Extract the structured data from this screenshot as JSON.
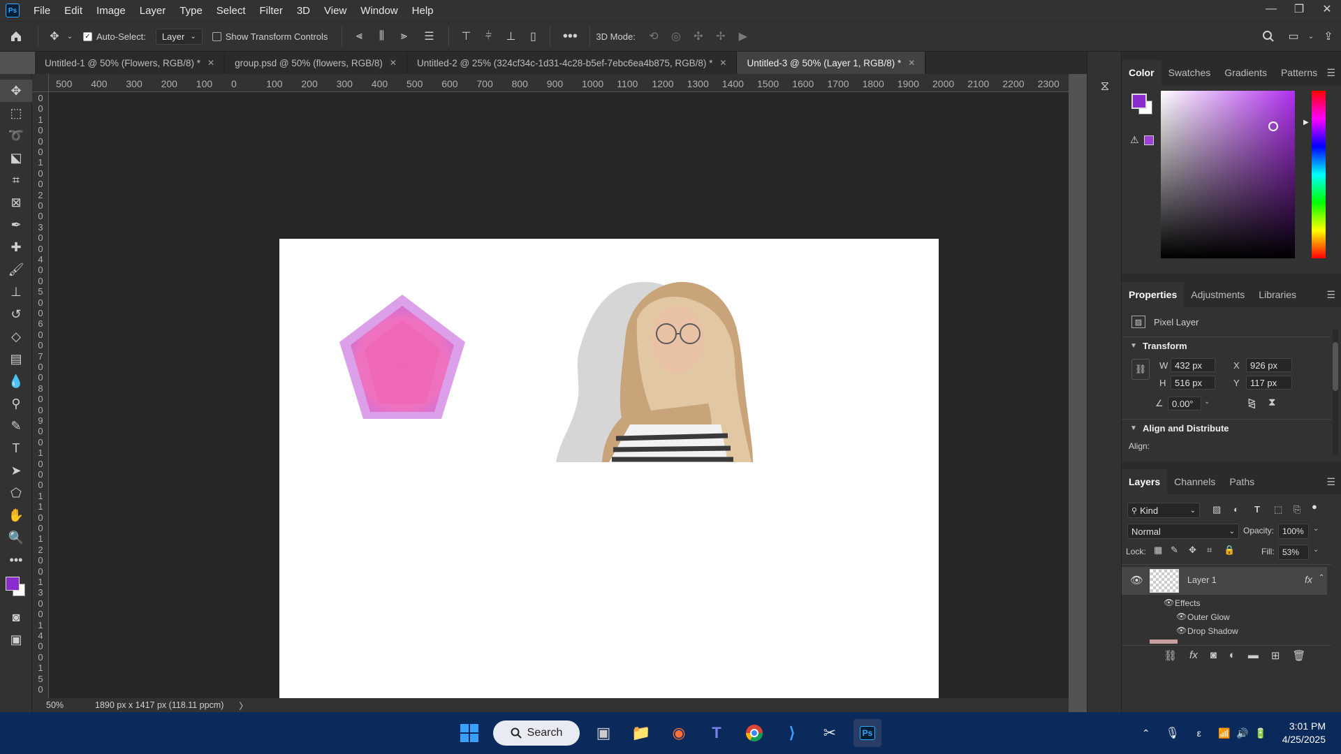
{
  "menubar": {
    "logo": "Ps",
    "items": [
      "File",
      "Edit",
      "Image",
      "Layer",
      "Type",
      "Select",
      "Filter",
      "3D",
      "View",
      "Window",
      "Help"
    ]
  },
  "options": {
    "auto_select_label": "Auto-Select:",
    "auto_select_value": "Layer",
    "show_transform_label": "Show Transform Controls",
    "three_d_mode_label": "3D Mode:"
  },
  "tabs": [
    {
      "label": "Untitled-1 @ 50% (Flowers, RGB/8) *",
      "active": false
    },
    {
      "label": "group.psd @ 50% (flowers, RGB/8)",
      "active": false
    },
    {
      "label": "Untitled-2 @ 25% (324cf34c-1d31-4c28-b5ef-7ebc6ea4b875, RGB/8) *",
      "active": false
    },
    {
      "label": "Untitled-3 @ 50% (Layer 1, RGB/8) *",
      "active": true
    }
  ],
  "ruler_top": [
    "500",
    "400",
    "300",
    "200",
    "100",
    "0",
    "100",
    "200",
    "300",
    "400",
    "500",
    "600",
    "700",
    "800",
    "900",
    "1000",
    "1100",
    "1200",
    "1300",
    "1400",
    "1500",
    "1600",
    "1700",
    "1800",
    "1900",
    "2000",
    "2100",
    "2200",
    "2300"
  ],
  "ruler_left": [
    "0",
    "0",
    "1",
    "0",
    "0",
    "0",
    "1",
    "0",
    "0",
    "2",
    "0",
    "0",
    "3",
    "0",
    "0",
    "4",
    "0",
    "0",
    "5",
    "0",
    "0",
    "6",
    "0",
    "0",
    "7",
    "0",
    "0",
    "8",
    "0",
    "0",
    "9",
    "0",
    "0",
    "1",
    "0",
    "0",
    "0",
    "1",
    "1",
    "0",
    "0",
    "1",
    "2",
    "0",
    "0",
    "1",
    "3",
    "0",
    "0",
    "1",
    "4",
    "0",
    "0",
    "1",
    "5",
    "0"
  ],
  "status": {
    "zoom": "50%",
    "doc_info": "1890 px x 1417 px (118.11 ppcm)",
    "arrow": "〉"
  },
  "color_panel": {
    "tabs": [
      "Color",
      "Swatches",
      "Gradients",
      "Patterns"
    ],
    "foreground": "#8a2bcc",
    "background": "#ffffff"
  },
  "properties_panel": {
    "tabs": [
      "Properties",
      "Adjustments",
      "Libraries"
    ],
    "layer_type": "Pixel Layer",
    "transform_title": "Transform",
    "w_label": "W",
    "w_value": "432 px",
    "h_label": "H",
    "h_value": "516 px",
    "x_label": "X",
    "x_value": "926 px",
    "y_label": "Y",
    "y_value": "117 px",
    "angle_value": "0.00°",
    "align_title": "Align and Distribute",
    "align_label": "Align:"
  },
  "layers_panel": {
    "tabs": [
      "Layers",
      "Channels",
      "Paths"
    ],
    "kind_label": "Kind",
    "blend_mode": "Normal",
    "opacity_label": "Opacity:",
    "opacity_value": "100%",
    "lock_label": "Lock:",
    "fill_label": "Fill:",
    "fill_value": "53%",
    "layer_name": "Layer 1",
    "fx_label": "fx",
    "effects_label": "Effects",
    "effect_1": "Outer Glow",
    "effect_2": "Drop Shadow"
  },
  "taskbar": {
    "search_label": "Search",
    "time": "3:01 PM",
    "date": "4/25/2025",
    "lang": "ε"
  },
  "colors": {
    "accent_purple": "#8a2bcc",
    "pentagon_pink": "#ef6fb8",
    "taskbar_bg": "#0b2a5c"
  }
}
